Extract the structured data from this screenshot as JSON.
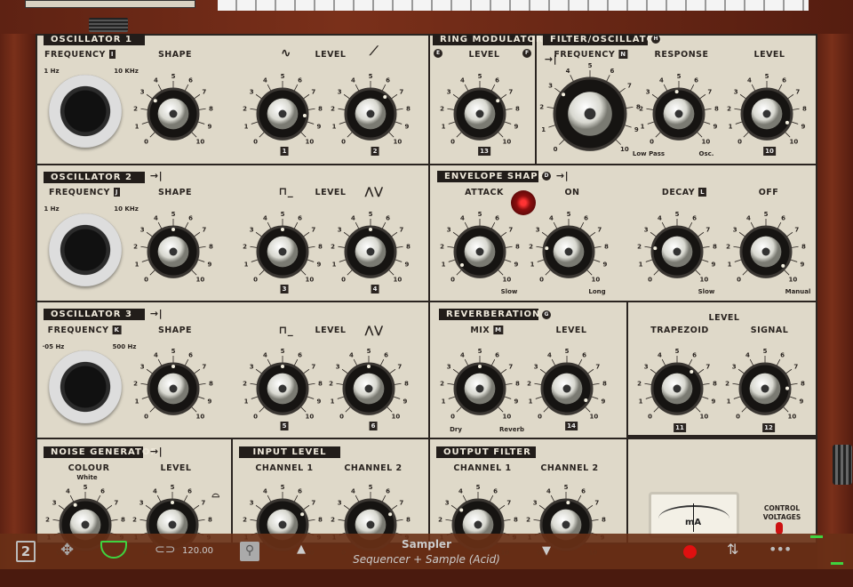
{
  "scale": [
    "0",
    "1",
    "2",
    "3",
    "4",
    "5",
    "6",
    "7",
    "8",
    "9",
    "10"
  ],
  "osc1": {
    "title": "OSCILLATOR 1",
    "frequency": "FREQUENCY",
    "freq_badge": "I",
    "shape": "SHAPE",
    "level": "LEVEL",
    "freq_low": "1 Hz",
    "freq_high": "10 KHz",
    "level1_num": "1",
    "level2_num": "2",
    "shape_value": 3,
    "level1_value": 8.5,
    "level2_value": 6.5
  },
  "ring": {
    "title": "RING MODULATOR",
    "level": "LEVEL",
    "left_badge": "E",
    "right_badge": "F",
    "num": "13",
    "value": 7
  },
  "filter": {
    "title": "FILTER/OSCILLATOR",
    "title_badge": "H",
    "frequency": "FREQUENCY",
    "freq_badge": "N",
    "response": "RESPONSE",
    "level": "LEVEL",
    "low_pass": "Low Pass",
    "osc": "Osc.",
    "level_num": "10",
    "freq_value": 3,
    "response_value": 4.8,
    "level_value": 9.2
  },
  "osc2": {
    "title": "OSCILLATOR 2",
    "frequency": "FREQUENCY",
    "freq_badge": "J",
    "shape": "SHAPE",
    "level": "LEVEL",
    "freq_low": "1 Hz",
    "freq_high": "10 KHz",
    "level1_num": "3",
    "level2_num": "4",
    "shape_value": 5,
    "level1_value": 5,
    "level2_value": 5
  },
  "envelope": {
    "title": "ENVELOPE SHAPER",
    "title_badge": "D",
    "attack": "ATTACK",
    "on": "ON",
    "decay": "DECAY",
    "decay_badge": "L",
    "off": "OFF",
    "slow1": "Slow",
    "long": "Long",
    "slow2": "Slow",
    "manual": "Manual",
    "attack_value": 0.3,
    "on_value": 2,
    "decay_value": 2,
    "off_value": 9.8
  },
  "osc3": {
    "title": "OSCILLATOR 3",
    "frequency": "FREQUENCY",
    "freq_badge": "K",
    "shape": "SHAPE",
    "level": "LEVEL",
    "freq_low": "·05 Hz",
    "freq_high": "500 Hz",
    "level1_num": "5",
    "level2_num": "6",
    "shape_value": 5,
    "level1_value": 5,
    "level2_value": 5
  },
  "reverb": {
    "title": "REVERBERATION",
    "title_badge": "G",
    "mix": "MIX",
    "mix_badge": "M",
    "level": "LEVEL",
    "dry": "Dry",
    "reverb": "Reverb",
    "level_num": "14",
    "mix_value": 5,
    "level_value": 9.5
  },
  "outlevel": {
    "level": "LEVEL",
    "trapezoid": "TRAPEZOID",
    "signal": "SIGNAL",
    "trap_num": "11",
    "signal_num": "12",
    "trap_value": 6.5,
    "signal_value": 8.3
  },
  "noise": {
    "title": "NOISE GENERATOR",
    "colour": "COLOUR",
    "white": "White",
    "level": "LEVEL",
    "colour_value": 4,
    "level_value": 5
  },
  "input": {
    "title": "INPUT LEVEL",
    "ch1": "CHANNEL 1",
    "ch2": "CHANNEL 2",
    "ch1_value": 7.3,
    "ch2_value": 7.3
  },
  "output": {
    "title": "OUTPUT FILTER",
    "ch1": "CHANNEL 1",
    "ch2": "CHANNEL 2",
    "ch1_value": 3.2,
    "ch2_value": 5.2
  },
  "meter": {
    "unit": "mA",
    "control": "CONTROL",
    "voltages": "VOLTAGES"
  },
  "toolbar": {
    "tempo": "120.00",
    "preset_name": "Sampler",
    "preset_sub": "Sequencer + Sample (Acid)",
    "accent": "#3fd33f",
    "record_color": "#e01010"
  }
}
